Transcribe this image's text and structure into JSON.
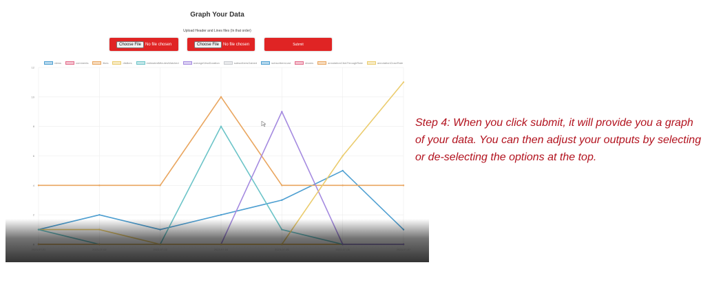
{
  "page": {
    "title": "Graph Your Data",
    "subtitle": "Upload Header and Lines files (In that order)",
    "file_inputs": [
      {
        "button": "Choose File",
        "status": "No file chosen"
      },
      {
        "button": "Choose File",
        "status": "No file chosen"
      }
    ],
    "submit_label": "Submit"
  },
  "caption": "Step 4: When you click submit, it will provide you a graph of your data. You can then adjust your outputs by selecting or de-selecting the options at the top.",
  "colors": {
    "button_red": "#e02424",
    "caption_red": "#b2121e"
  },
  "chart_data": {
    "type": "line",
    "categories": [
      "2023-07-01",
      "2023-07-02",
      "2023-07-03",
      "2023-07-04",
      "2023-07-05",
      "2023-07-06",
      "2023-07-07"
    ],
    "ylim": [
      0,
      12
    ],
    "yticks": [
      "0",
      "2",
      "4",
      "6",
      "8",
      "10",
      "12"
    ],
    "grid": true,
    "legend_position": "top",
    "series": [
      {
        "name": "views",
        "color": "#4e9fd1",
        "values": [
          1,
          2,
          1,
          2,
          3,
          5,
          1
        ]
      },
      {
        "name": "comments",
        "color": "#e36b8a",
        "values": [
          0,
          0,
          0,
          0,
          0,
          0,
          0
        ]
      },
      {
        "name": "likes",
        "color": "#e9a55e",
        "values": [
          4,
          4,
          4,
          10,
          4,
          4,
          4
        ]
      },
      {
        "name": "dislikes",
        "color": "#ebcc6e",
        "values": [
          1,
          1,
          0,
          0,
          0,
          0,
          0
        ]
      },
      {
        "name": "estimatedMinutesWatched",
        "color": "#6cc4c8",
        "values": [
          1,
          0,
          0,
          8,
          1,
          0,
          0
        ]
      },
      {
        "name": "averageViewDuration",
        "color": "#a58be0",
        "values": [
          0,
          0,
          0,
          0,
          9,
          0,
          0
        ]
      },
      {
        "name": "subscribersGained",
        "color": "#c8cbd0",
        "values": [
          0,
          0,
          0,
          0,
          0,
          0,
          0
        ]
      },
      {
        "name": "subscribersLost",
        "color": "#4e9fd1",
        "values": [
          0,
          0,
          0,
          0,
          0,
          0,
          0
        ]
      },
      {
        "name": "shares",
        "color": "#e36b8a",
        "values": [
          0,
          0,
          0,
          0,
          0,
          0,
          0
        ]
      },
      {
        "name": "annotationClickThroughRate",
        "color": "#e9a55e",
        "values": [
          0,
          0,
          0,
          0,
          0,
          0,
          0
        ]
      },
      {
        "name": "annotationCloseRate",
        "color": "#ebcc6e",
        "values": [
          0,
          0,
          0,
          0,
          0,
          6,
          11
        ]
      }
    ]
  }
}
